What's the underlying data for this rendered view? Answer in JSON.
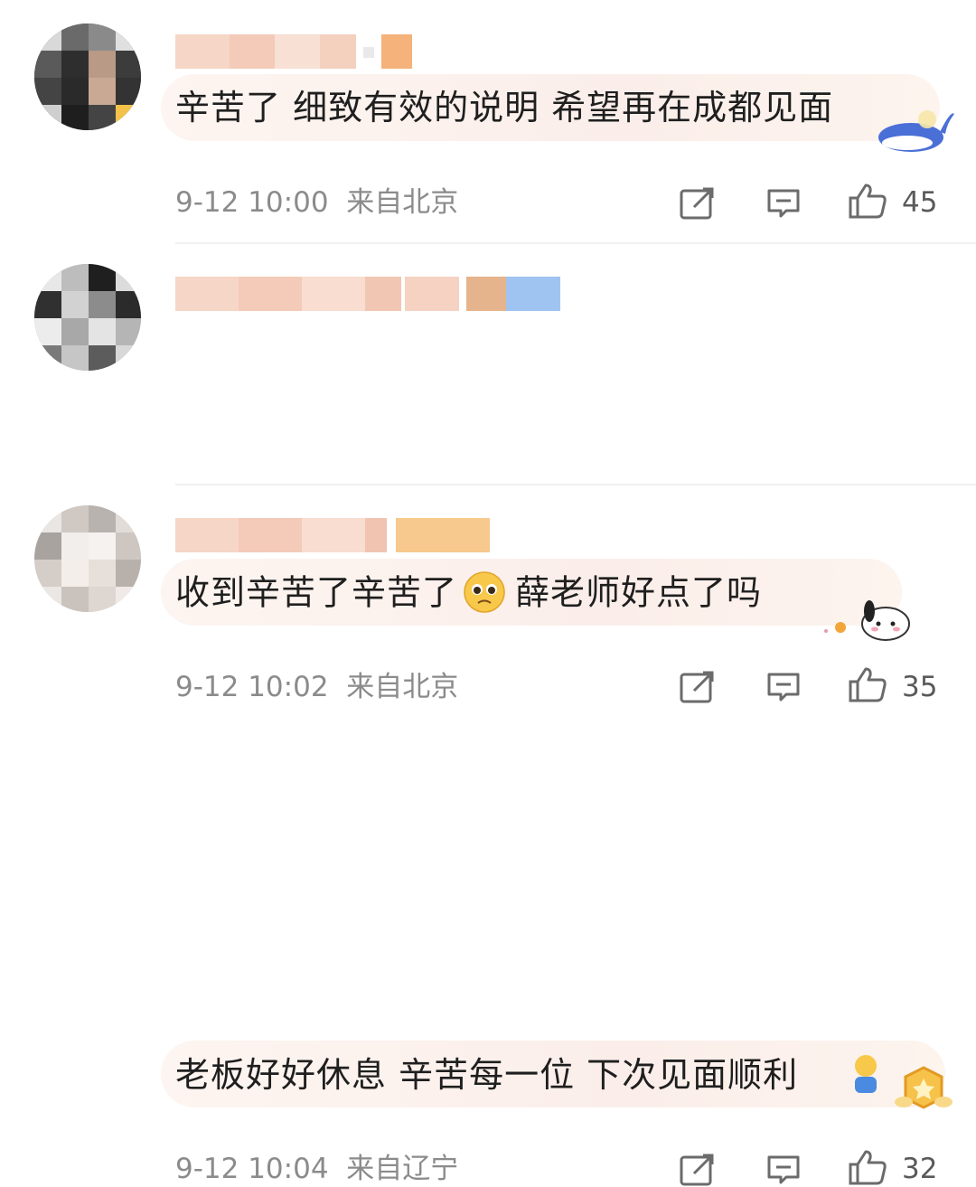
{
  "comments": [
    {
      "text": "辛苦了 细致有效的说明 希望再在成都见面",
      "date": "9-12 10:00",
      "location": "来自北京",
      "likes": "45"
    },
    {
      "text_before": "收到辛苦了辛苦了",
      "text_after": "薛老师好点了吗",
      "emoji": "pleading-face-emoji",
      "date": "9-12 10:02",
      "location": "来自北京",
      "likes": "35"
    },
    {
      "text": "老板好好休息 辛苦每一位 下次见面顺利",
      "date": "9-12 10:04",
      "location": "来自辽宁",
      "likes": "32"
    }
  ],
  "icons": {
    "share": "share-icon",
    "reply": "reply-icon",
    "like": "thumbs-up-icon"
  },
  "colors": {
    "bubble": "#fbeeea",
    "meta_text": "#8b8b8b",
    "divider": "#f0f0f0"
  }
}
